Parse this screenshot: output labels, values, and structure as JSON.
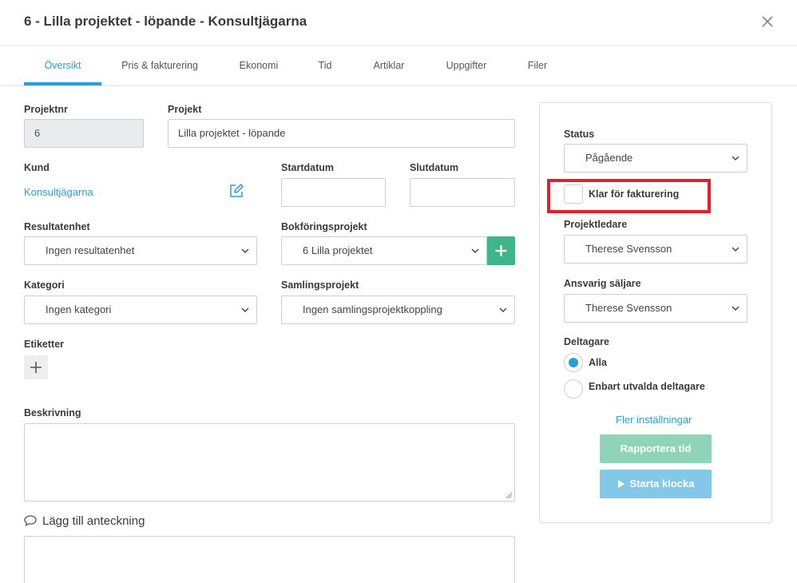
{
  "header": {
    "title": "6 - Lilla projektet - löpande - Konsultjägarna"
  },
  "tabs": [
    "Översikt",
    "Pris & fakturering",
    "Ekonomi",
    "Tid",
    "Artiklar",
    "Uppgifter",
    "Filer"
  ],
  "form": {
    "projektnr_label": "Projektnr",
    "projektnr_value": "6",
    "projekt_label": "Projekt",
    "projekt_value": "Lilla projektet - löpande",
    "kund_label": "Kund",
    "kund_value": "Konsultjägarna",
    "startdatum_label": "Startdatum",
    "startdatum_value": "",
    "slutdatum_label": "Slutdatum",
    "slutdatum_value": "",
    "resultatenhet_label": "Resultatenhet",
    "resultatenhet_value": "Ingen resultatenhet",
    "bokforingsprojekt_label": "Bokföringsprojekt",
    "bokforingsprojekt_value": "6 Lilla projektet",
    "kategori_label": "Kategori",
    "kategori_value": "Ingen kategori",
    "samlingsprojekt_label": "Samlingsprojekt",
    "samlingsprojekt_value": "Ingen samlingsprojektkoppling",
    "etiketter_label": "Etiketter",
    "beskrivning_label": "Beskrivning",
    "anteckning_label": "Lägg till anteckning"
  },
  "side": {
    "status_label": "Status",
    "status_value": "Pågående",
    "klar_label": "Klar för fakturering",
    "projektledare_label": "Projektledare",
    "projektledare_value": "Therese Svensson",
    "saljare_label": "Ansvarig säljare",
    "saljare_value": "Therese Svensson",
    "deltagare_label": "Deltagare",
    "deltagare_options": [
      "Alla",
      "Enbart utvalda deltagare"
    ],
    "fler_link": "Fler inställningar",
    "report_button": "Rapportera tid",
    "clock_button": "Starta klocka"
  },
  "colors": {
    "accent": "#2a9fd6",
    "green": "#3fb68a",
    "highlight": "#e0202a"
  }
}
